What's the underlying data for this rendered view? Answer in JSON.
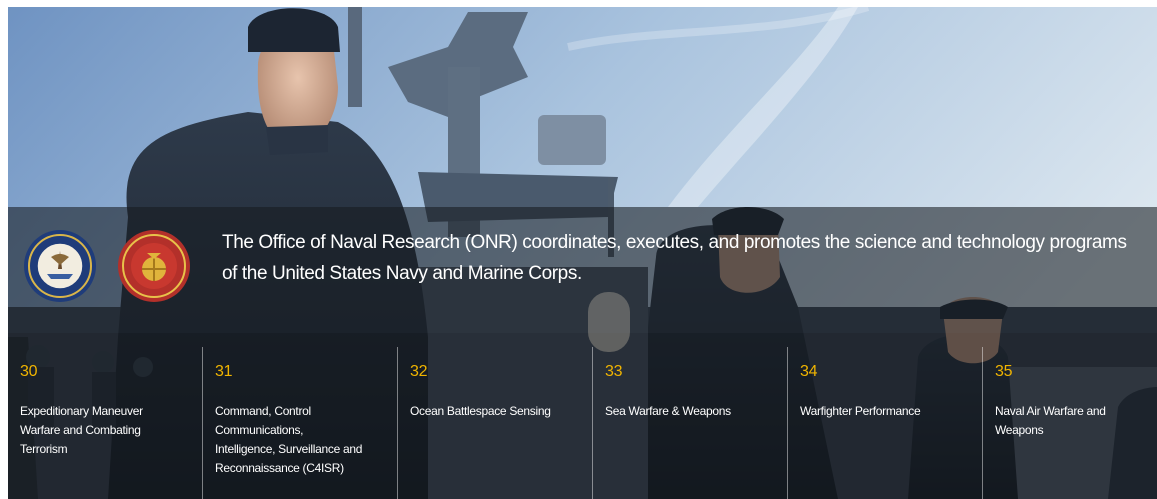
{
  "hero": {
    "image": "sailors-on-ship-deck-photo",
    "mission": "The Office of Naval Research (ONR) coordinates, executes, and promotes the science and technology programs of the United States Navy and Marine Corps.",
    "seals": [
      "navy-seal-icon",
      "marine-corps-seal-icon"
    ],
    "accent_color": "#f0b400"
  },
  "codes": [
    {
      "number": "30",
      "label": "Expeditionary Maneuver Warfare and Combating Terrorism"
    },
    {
      "number": "31",
      "label": "Command, Control Communications, Intelligence, Surveillance and Reconnaissance (C4ISR)"
    },
    {
      "number": "32",
      "label": "Ocean Battlespace Sensing"
    },
    {
      "number": "33",
      "label": "Sea Warfare & Weapons"
    },
    {
      "number": "34",
      "label": "Warfighter Performance"
    },
    {
      "number": "35",
      "label": "Naval Air Warfare and Weapons"
    }
  ]
}
